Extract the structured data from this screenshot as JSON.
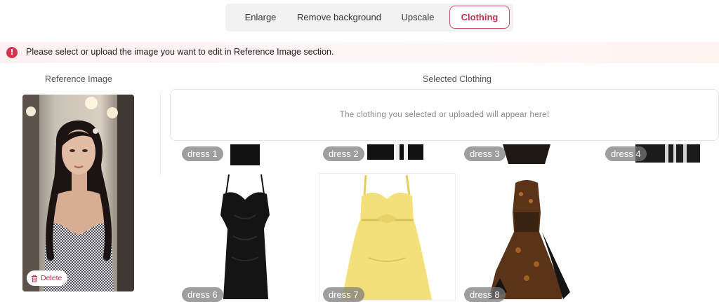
{
  "tabs": [
    {
      "label": "Enlarge",
      "active": false
    },
    {
      "label": "Remove background",
      "active": false
    },
    {
      "label": "Upscale",
      "active": false
    },
    {
      "label": "Clothing",
      "active": true
    }
  ],
  "alert": {
    "icon": "info-icon",
    "text": "Please select or upload the image you want to edit in Reference Image section."
  },
  "reference": {
    "title": "Reference Image",
    "delete_label": "Delete",
    "delete_icon": "trash-icon"
  },
  "selected_clothing": {
    "title": "Selected Clothing",
    "placeholder": "The clothing you selected or uploaded will appear here!"
  },
  "dresses_top": [
    "dress 1",
    "dress 2",
    "dress 3",
    "dress 4"
  ],
  "dresses_bottom": [
    "dress 6",
    "dress 7",
    "dress 8"
  ],
  "colors": {
    "accent": "#c0304f",
    "alert_icon": "#d9344f"
  }
}
